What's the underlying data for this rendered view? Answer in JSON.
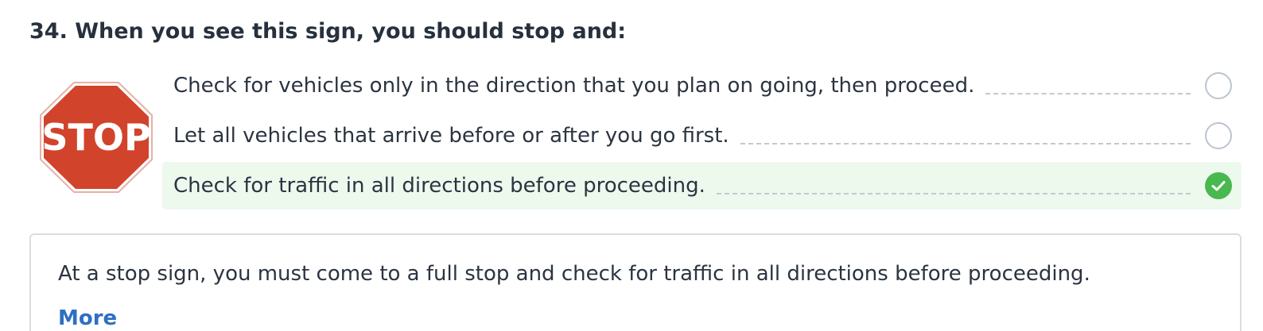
{
  "question": {
    "number": "34.",
    "title": "34. When you see this sign, you should stop and:"
  },
  "sign": {
    "text": "STOP",
    "icon": "stop-sign-icon",
    "color": "#d2432c"
  },
  "answers": [
    {
      "text": "Check for vehicles only in the direction that you plan on going, then proceed.",
      "state": "unselected"
    },
    {
      "text": "Let all vehicles that arrive before or after you go first.",
      "state": "unselected"
    },
    {
      "text": "Check for traffic in all directions before proceeding.",
      "state": "correct"
    }
  ],
  "explanation": {
    "text": "At a stop sign, you must come to a full stop and check for traffic in all directions before proceeding.",
    "more_label": "More"
  },
  "colors": {
    "correct_background": "#eef9ee",
    "correct_check": "#49b84f",
    "link": "#2f6fc3"
  }
}
